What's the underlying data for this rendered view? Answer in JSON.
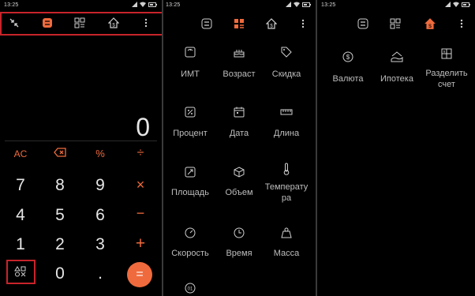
{
  "status": {
    "time": "13:25"
  },
  "panel1": {
    "display_value": "0",
    "keys": {
      "ac": "AC",
      "percent": "%",
      "divide": "÷",
      "multiply": "×",
      "minus": "−",
      "plus": "+",
      "d7": "7",
      "d8": "8",
      "d9": "9",
      "d4": "4",
      "d5": "5",
      "d6": "6",
      "d1": "1",
      "d2": "2",
      "d3": "3",
      "d0": "0",
      "dot": ".",
      "equals": "="
    }
  },
  "panel2": {
    "items": [
      {
        "label": "ИМТ",
        "icon": "scale-icon"
      },
      {
        "label": "Возраст",
        "icon": "cake-icon"
      },
      {
        "label": "Скидка",
        "icon": "tag-icon"
      },
      {
        "label": "Процент",
        "icon": "percent-icon"
      },
      {
        "label": "Дата",
        "icon": "calendar-icon"
      },
      {
        "label": "Длина",
        "icon": "ruler-icon"
      },
      {
        "label": "Площадь",
        "icon": "area-icon"
      },
      {
        "label": "Объем",
        "icon": "cube-icon"
      },
      {
        "label": "Температура",
        "label_line1": "Температу",
        "label_line2": "ра",
        "icon": "thermometer-icon"
      },
      {
        "label": "Скорость",
        "icon": "speedometer-icon"
      },
      {
        "label": "Время",
        "icon": "clock-icon"
      },
      {
        "label": "Масса",
        "icon": "weight-icon"
      }
    ]
  },
  "panel3": {
    "items": [
      {
        "label": "Валюта",
        "icon": "currency-icon"
      },
      {
        "label": "Ипотека",
        "icon": "mortgage-icon"
      },
      {
        "label": "Разделить счет",
        "label_line1": "Разделить",
        "label_line2": "счет",
        "icon": "split-bill-icon"
      }
    ]
  },
  "colors": {
    "accent": "#ef6b3d",
    "highlight_box": "#c7242b",
    "background": "#000000",
    "text": "#cfcfcf"
  }
}
